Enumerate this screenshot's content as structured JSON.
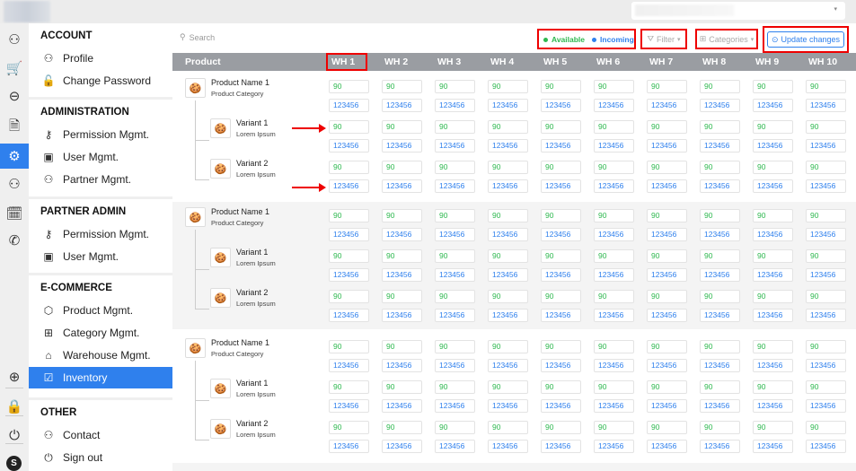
{
  "topbar": {
    "select_caret": "▾"
  },
  "rail": {
    "icons": [
      {
        "name": "add-user-icon",
        "glyph": "⚇"
      },
      {
        "name": "cart-icon",
        "glyph": "🛒"
      },
      {
        "name": "pills-icon",
        "glyph": "⊖"
      },
      {
        "name": "document-icon",
        "glyph": "🗎"
      },
      {
        "name": "gear-icon",
        "glyph": "⚙"
      },
      {
        "name": "user-stats-icon",
        "glyph": "⚇"
      },
      {
        "name": "calendar-clock-icon",
        "glyph": "🗓"
      },
      {
        "name": "phone-icon",
        "glyph": "✆"
      },
      {
        "name": "plus-circle-icon",
        "glyph": "⊕"
      },
      {
        "name": "lock-icon",
        "glyph": "🔒"
      },
      {
        "name": "power-icon",
        "glyph": "⏻"
      }
    ],
    "avatar": "S"
  },
  "menu": {
    "sections": [
      {
        "title": "ACCOUNT",
        "items": [
          {
            "label": "Profile",
            "glyph": "⚇"
          },
          {
            "label": "Change Password",
            "glyph": "🔓"
          }
        ]
      },
      {
        "title": "ADMINISTRATION",
        "items": [
          {
            "label": "Permission Mgmt.",
            "glyph": "⚷"
          },
          {
            "label": "User Mgmt.",
            "glyph": "▣"
          },
          {
            "label": "Partner Mgmt.",
            "glyph": "⚇"
          }
        ]
      },
      {
        "title": "PARTNER ADMIN",
        "items": [
          {
            "label": "Permission Mgmt.",
            "glyph": "⚷"
          },
          {
            "label": "User Mgmt.",
            "glyph": "▣"
          }
        ]
      },
      {
        "title": "E-COMMERCE",
        "items": [
          {
            "label": "Product Mgmt.",
            "glyph": "⬡"
          },
          {
            "label": "Category Mgmt.",
            "glyph": "⊞"
          },
          {
            "label": "Warehouse Mgmt.",
            "glyph": "⌂"
          },
          {
            "label": "Inventory",
            "glyph": "☑"
          }
        ]
      },
      {
        "title": "OTHER",
        "items": [
          {
            "label": "Contact",
            "glyph": "⚇"
          },
          {
            "label": "Sign out",
            "glyph": "⏻"
          }
        ]
      }
    ],
    "active": "Inventory"
  },
  "toolbar": {
    "search_placeholder": "Search",
    "search_icon": "⚲",
    "legend_available": "Available",
    "legend_incoming": "Incoming",
    "filter_label": "Filter",
    "categories_label": "Categories",
    "update_label": "Update changes",
    "caret": "▾"
  },
  "colors": {
    "available": "#2eb84f",
    "incoming": "#2f80ed",
    "accent": "#2f80ed",
    "header": "#9a9da2",
    "highlight": "#e00000"
  },
  "table": {
    "product_header": "Product",
    "warehouses": [
      "WH 1",
      "WH 2",
      "WH 3",
      "WH 4",
      "WH 5",
      "WH 6",
      "WH 7",
      "WH 8",
      "WH 9",
      "WH 10"
    ],
    "groups": [
      {
        "rows": [
          {
            "name": "Product Name 1",
            "sub": "Product Category",
            "available": 90,
            "incoming": 123456
          },
          {
            "name": "Variant 1",
            "sub": "Lorem Ipsum",
            "available": 90,
            "incoming": 123456
          },
          {
            "name": "Variant 2",
            "sub": "Lorem Ipsum",
            "available": 90,
            "incoming": 123456
          }
        ]
      },
      {
        "rows": [
          {
            "name": "Product Name 1",
            "sub": "Product Category",
            "available": 90,
            "incoming": 123456
          },
          {
            "name": "Variant 1",
            "sub": "Lorem Ipsum",
            "available": 90,
            "incoming": 123456
          },
          {
            "name": "Variant 2",
            "sub": "Lorem Ipsum",
            "available": 90,
            "incoming": 123456
          }
        ]
      },
      {
        "rows": [
          {
            "name": "Product Name 1",
            "sub": "Product Category",
            "available": 90,
            "incoming": 123456
          },
          {
            "name": "Variant 1",
            "sub": "Lorem Ipsum",
            "available": 90,
            "incoming": 123456
          },
          {
            "name": "Variant 2",
            "sub": "Lorem Ipsum",
            "available": 90,
            "incoming": 123456
          }
        ]
      }
    ]
  }
}
